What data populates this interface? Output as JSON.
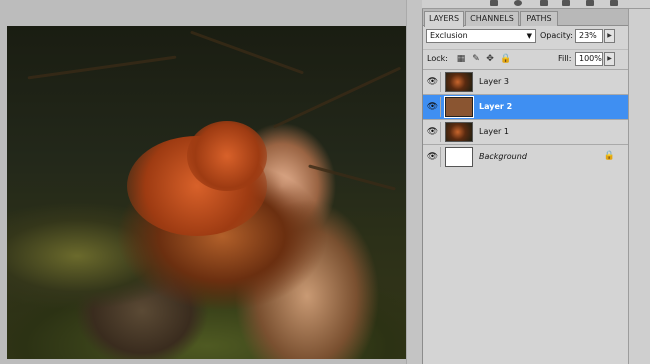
{
  "tabs": [
    {
      "label": "LAYERS",
      "active": true
    },
    {
      "label": "CHANNELS",
      "active": false
    },
    {
      "label": "PATHS",
      "active": false
    }
  ],
  "options": {
    "blend_mode": "Exclusion",
    "opacity_label": "Opacity:",
    "opacity_value": "23%",
    "lock_label": "Lock:",
    "fill_label": "Fill:",
    "fill_value": "100%"
  },
  "layers": [
    {
      "name": "Layer 3",
      "thumb": "photo",
      "selected": false,
      "italic": false,
      "visible": true
    },
    {
      "name": "Layer 2",
      "thumb": "solid-brown",
      "selected": true,
      "italic": false,
      "visible": true
    },
    {
      "name": "Layer 1",
      "thumb": "photo",
      "selected": false,
      "italic": false,
      "visible": true
    },
    {
      "name": "Background",
      "thumb": "white",
      "selected": false,
      "italic": true,
      "visible": true,
      "locked": true
    }
  ],
  "icons": {
    "eye": "eye-icon",
    "lock": "lock-icon"
  },
  "colors": {
    "selection": "#3f8ff2",
    "panel_bg": "#d4d4d4",
    "layer2_fill": "#8a5531"
  }
}
